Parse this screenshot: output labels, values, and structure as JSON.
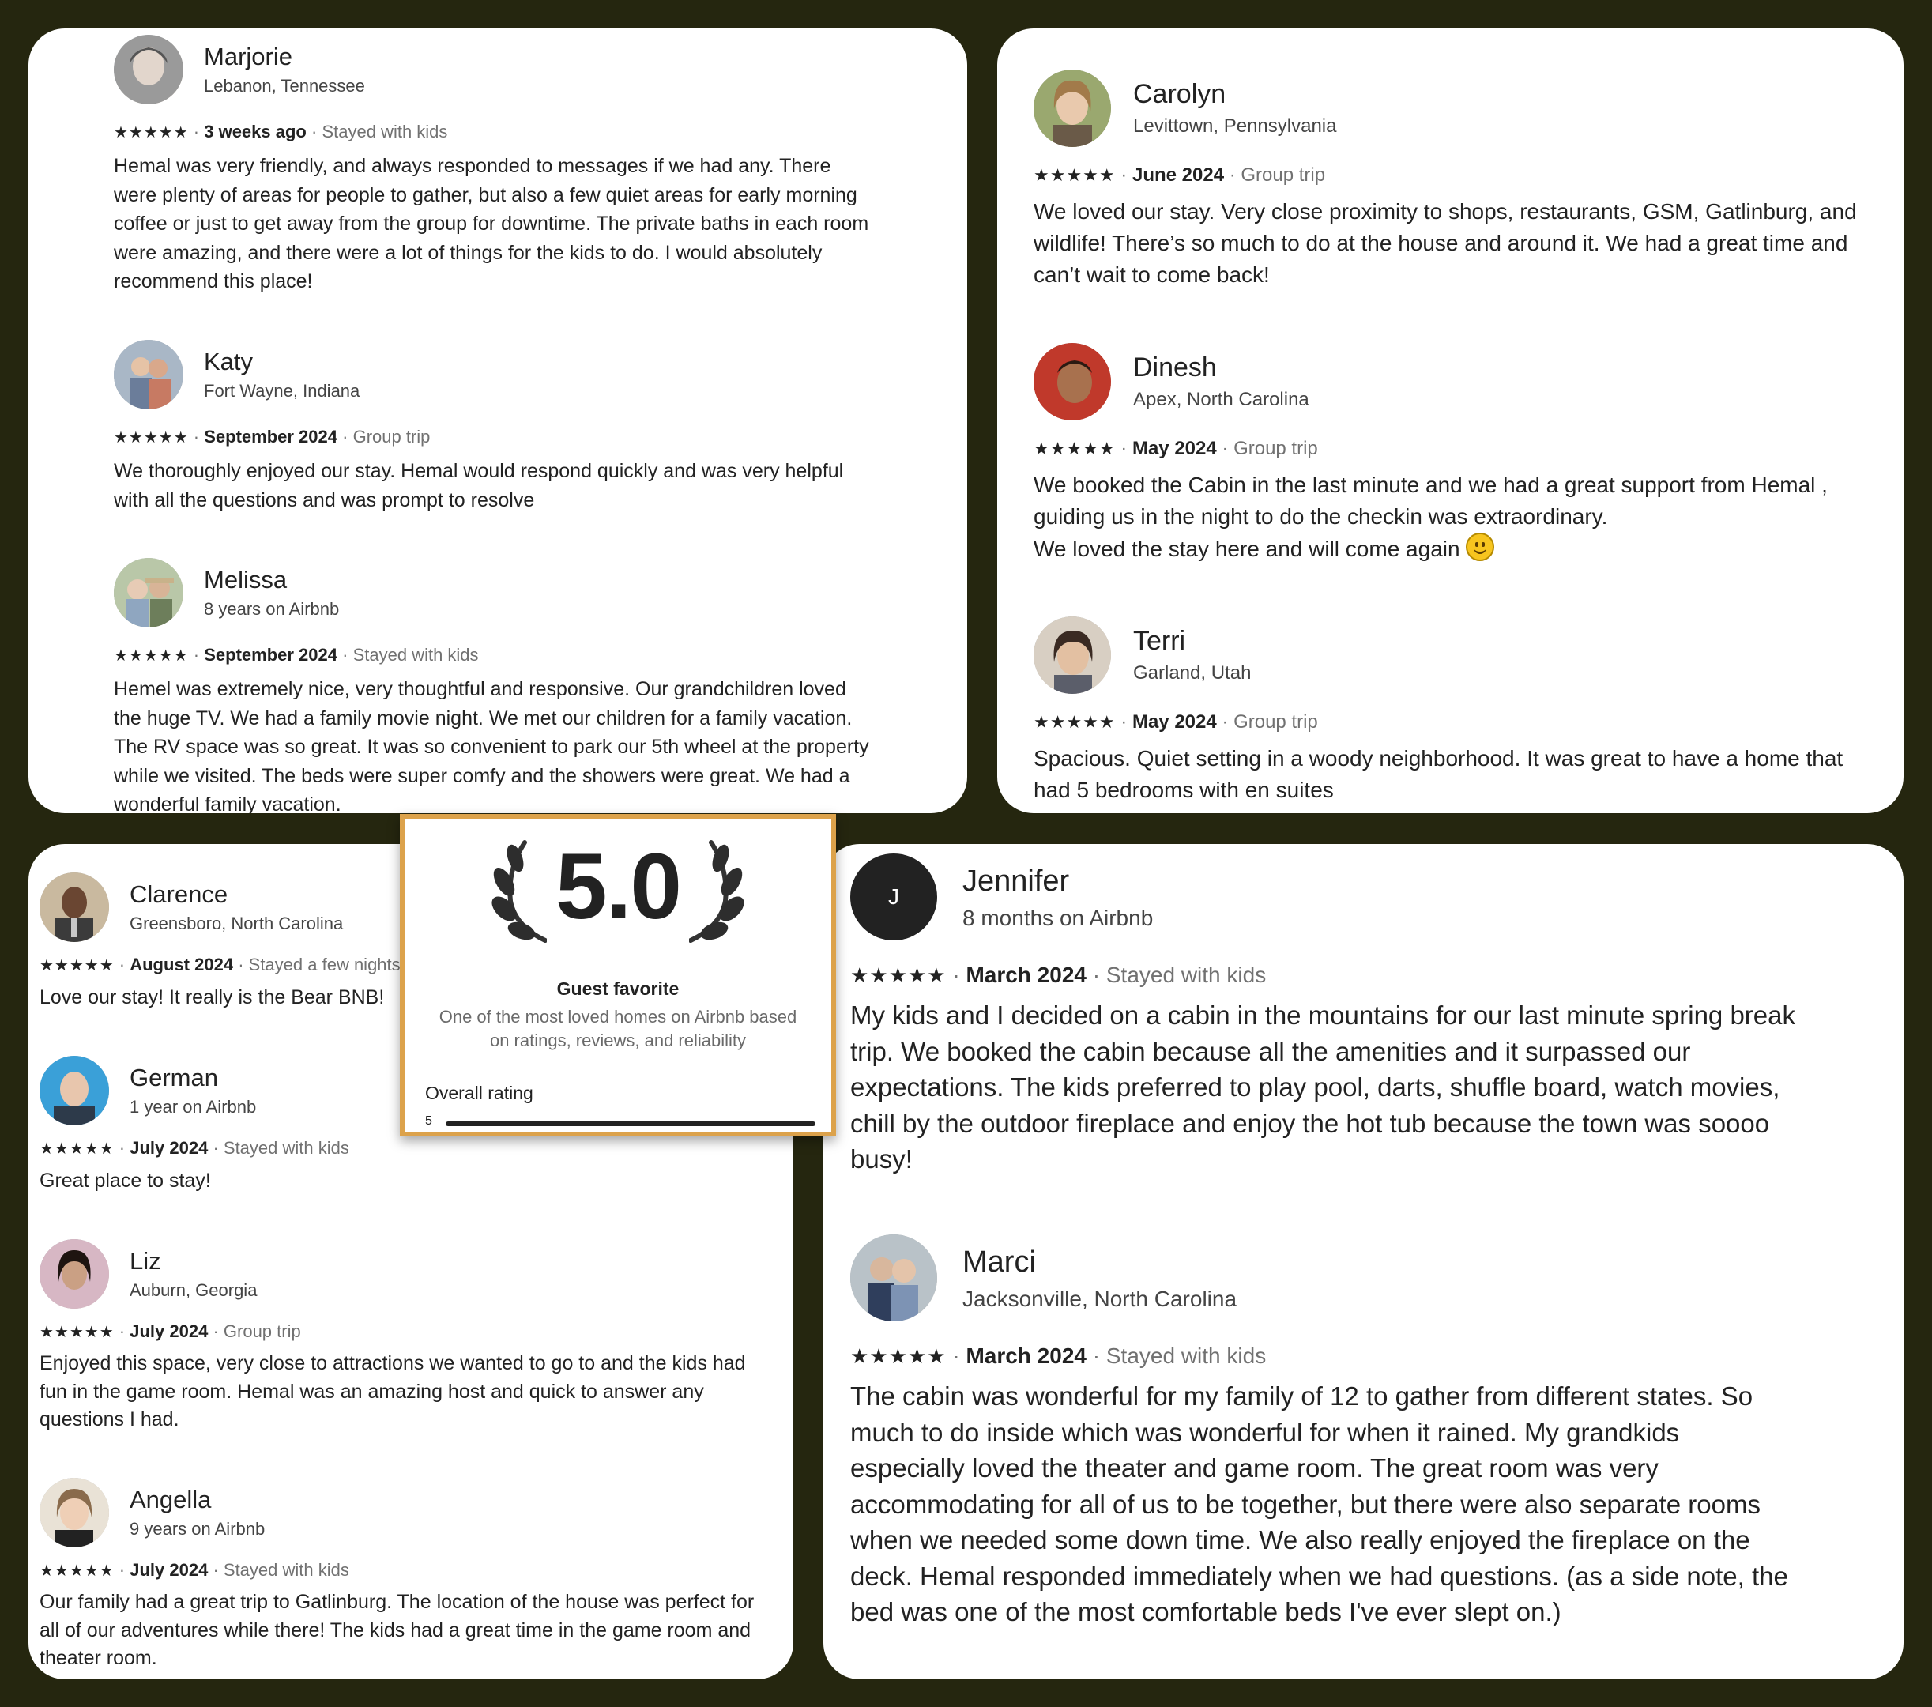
{
  "reviews": {
    "marjorie": {
      "name": "Marjorie",
      "location": "Lebanon, Tennessee",
      "stars": "★★★★★",
      "date": "3 weeks ago",
      "trip": "Stayed with kids",
      "text": "Hemal was very friendly, and always responded to messages if we had any. There were plenty of areas for people to gather, but also a few quiet areas for early morning coffee or just to get away from the group for downtime. The private baths in each room were amazing, and there were a lot of things for the kids to do. I would absolutely recommend this place!"
    },
    "katy": {
      "name": "Katy",
      "location": "Fort Wayne, Indiana",
      "stars": "★★★★★",
      "date": "September 2024",
      "trip": "Group trip",
      "text": "We thoroughly enjoyed our stay. Hemal would respond quickly and was very helpful with all the questions and was prompt to resolve"
    },
    "melissa": {
      "name": "Melissa",
      "location": "8 years on Airbnb",
      "stars": "★★★★★",
      "date": "September 2024",
      "trip": "Stayed with kids",
      "text": "Hemel was extremely nice, very thoughtful and responsive. Our grandchildren loved the huge TV. We had a family movie night. We met our children for a family vacation. The RV space was so great. It was so convenient to park our 5th wheel at the property while we visited. The beds were super comfy and the showers were great. We had a wonderful family vacation."
    },
    "carolyn": {
      "name": "Carolyn",
      "location": "Levittown, Pennsylvania",
      "stars": "★★★★★",
      "date": "June 2024",
      "trip": "Group trip",
      "text": "We loved our stay. Very close proximity to shops, restaurants, GSM, Gatlinburg, and wildlife! There’s so much to do at the house and around it. We had a great time and can’t wait to come back!"
    },
    "dinesh": {
      "name": "Dinesh",
      "location": "Apex, North Carolina",
      "stars": "★★★★★",
      "date": "May 2024",
      "trip": "Group trip",
      "text_line1": "We booked the Cabin in the last minute and we had a great support from Hemal , guiding us in the night to do the checkin was extraordinary.",
      "text_line2": "We loved the stay here and will come again"
    },
    "terri": {
      "name": "Terri",
      "location": "Garland, Utah",
      "stars": "★★★★★",
      "date": "May 2024",
      "trip": "Group trip",
      "text": "Spacious. Quiet setting in a woody neighborhood. It was great to have a home that had 5 bedrooms with en suites"
    },
    "clarence": {
      "name": "Clarence",
      "location": "Greensboro, North Carolina",
      "stars": "★★★★★",
      "date": "August 2024",
      "trip": "Stayed a few nights",
      "text": "Love our stay! It really is the Bear BNB!"
    },
    "german": {
      "name": "German",
      "location": "1 year on Airbnb",
      "stars": "★★★★★",
      "date": "July 2024",
      "trip": "Stayed with kids",
      "text": "Great place to stay!"
    },
    "liz": {
      "name": "Liz",
      "location": "Auburn, Georgia",
      "stars": "★★★★★",
      "date": "July 2024",
      "trip": "Group trip",
      "text": "Enjoyed this space, very close to attractions we wanted to go to and the kids had fun in the game room. Hemal was an amazing host and quick to answer any questions I had."
    },
    "angella": {
      "name": "Angella",
      "location": "9 years on Airbnb",
      "stars": "★★★★★",
      "date": "July 2024",
      "trip": "Stayed with kids",
      "text": "Our family had a great trip to Gatlinburg. The location of the house was perfect for all of our adventures while there! The kids had a great time in the game room and theater room."
    },
    "jennifer": {
      "name": "Jennifer",
      "initial": "J",
      "location": "8 months on Airbnb",
      "stars": "★★★★★",
      "date": "March 2024",
      "trip": "Stayed with kids",
      "text": "My kids and I decided on a cabin in the mountains for our last minute spring break trip. We booked the cabin because all the amenities and it surpassed our expectations. The kids preferred to play pool, darts, shuffle board, watch movies, chill by the outdoor fireplace and enjoy the hot tub because the town was soooo busy!"
    },
    "marci": {
      "name": "Marci",
      "location": "Jacksonville, North Carolina",
      "stars": "★★★★★",
      "date": "March 2024",
      "trip": "Stayed with kids",
      "text": "The cabin was wonderful for my family of 12 to gather from different states. So much to do inside which was wonderful for when it rained. My grandkids especially loved the theater and game room. The great room was very accommodating for all of us to be together, but there were also separate rooms when we needed some down time. We also really enjoyed the fireplace on the deck. Hemal responded immediately when we had questions. (as a side note, the bed was one of the most comfortable beds I've ever slept on.)"
    }
  },
  "separator": "·",
  "guest_favorite": {
    "score": "5.0",
    "title": "Guest favorite",
    "description": "One of the most loved homes on Airbnb based on ratings, reviews, and reliability",
    "overall_label": "Overall rating",
    "overall_row_label": "5",
    "overall_fill_fraction": 1.0
  },
  "colors": {
    "background": "#25260f",
    "badge_border": "#dca24b",
    "text": "#222222",
    "muted": "#717171"
  }
}
